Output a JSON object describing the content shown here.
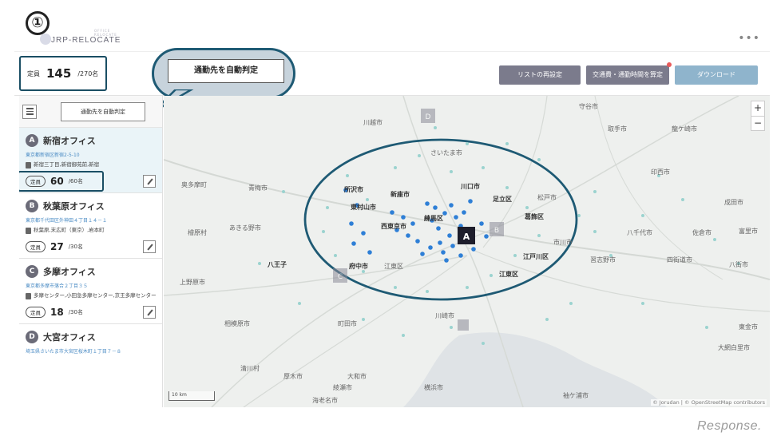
{
  "step_marker": "①",
  "logo": {
    "text": "JRP-RELOCATE",
    "subtext": "OFFICE RELOCATE"
  },
  "header": {
    "menu": "•••",
    "capacity_label": "定員",
    "capacity_value": "145",
    "capacity_max": "/270名",
    "auto_button": "通勤先を自動判定",
    "reset_button": "リストの再設定",
    "calc_button": "交通費・通勤時間を算定",
    "download_button": "ダウンロード"
  },
  "sidebar": {
    "auto_button": "通勤先を自動判定",
    "offices": [
      {
        "letter": "A",
        "name": "新宿オフィス",
        "address": "東京都新宿区新宿2-5-10",
        "station": "新宿三丁目,新宿御苑前,新宿",
        "cap_label": "定員",
        "cap_value": "60",
        "cap_max": "/60名"
      },
      {
        "letter": "B",
        "name": "秋葉原オフィス",
        "address": "東京都千代田区外神田４丁目１４－１",
        "station": "秋葉原,末広町（東京）,岩本町",
        "cap_label": "定員",
        "cap_value": "27",
        "cap_max": "/30名"
      },
      {
        "letter": "C",
        "name": "多摩オフィス",
        "address": "東京都多摩市落合２丁目３５",
        "station": "多摩センター,小田急多摩センター,京王多摩センター",
        "cap_label": "定員",
        "cap_value": "18",
        "cap_max": "/30名"
      },
      {
        "letter": "D",
        "name": "大宮オフィス",
        "address": "埼玉県さいたま市大宮区桜木町１丁目７－８"
      }
    ]
  },
  "map": {
    "places": [
      "川越市",
      "守谷市",
      "取手市",
      "龍ケ崎市",
      "さいたま市",
      "印西市",
      "奥多摩町",
      "青梅市",
      "所沢市",
      "川口市",
      "足立区",
      "松戸市",
      "新座市",
      "東村山市",
      "練馬区",
      "葛飾区",
      "成田市",
      "あきる野市",
      "西東京市",
      "八千代市",
      "佐倉市",
      "富里市",
      "檜原村",
      "八王子",
      "府中市",
      "江東区",
      "江戸川区",
      "習志野市",
      "四街道市",
      "上野原市",
      "市川市",
      "八街市",
      "江東区",
      "相模原市",
      "町田市",
      "東金市",
      "川崎市",
      "大網白里市",
      "厚木市",
      "大和市",
      "綾瀬市",
      "横浜市",
      "袖ケ浦市",
      "海老名市",
      "清川村"
    ],
    "office_markers": [
      "A",
      "B",
      "C",
      "D"
    ],
    "zoom_in": "+",
    "zoom_out": "−",
    "scale": "10 km",
    "attribution": "© Jorudan | © OpenStreetMap contributors"
  },
  "watermark": "Response."
}
